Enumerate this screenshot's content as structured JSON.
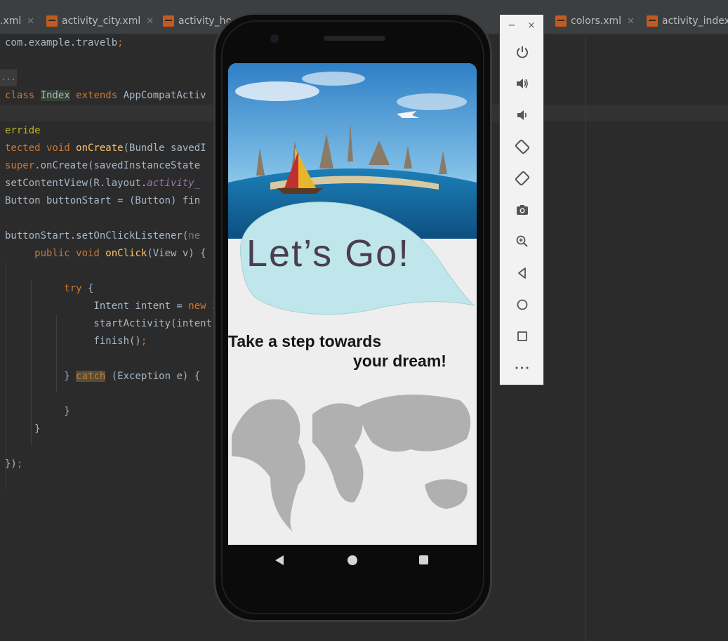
{
  "top_tabs": [
    {
      "label": ".xml"
    },
    {
      "label": "activity_city.xml"
    },
    {
      "label": "activity_ho"
    },
    {
      "label": "colors.xml"
    },
    {
      "label": "activity_index.x"
    }
  ],
  "editor": {
    "lines": [
      {
        "segments": [
          {
            "text": "com.example.travelb",
            "cls": ""
          },
          {
            "text": ";",
            "cls": "kw"
          }
        ]
      },
      {
        "segments": []
      },
      {
        "segments": []
      },
      {
        "segments": [
          {
            "text": "class ",
            "cls": "kw"
          },
          {
            "text": "Index",
            "cls": "cls-hl"
          },
          {
            "text": " extends ",
            "cls": "kw"
          },
          {
            "text": "AppCompatActiv",
            "cls": ""
          }
        ]
      },
      {
        "segments": []
      },
      {
        "segments": [
          {
            "text": "erride",
            "cls": "ann"
          }
        ]
      },
      {
        "segments": [
          {
            "text": "tected void ",
            "cls": "kw"
          },
          {
            "text": "onCreate",
            "cls": "fn"
          },
          {
            "text": "(Bundle savedI",
            "cls": ""
          }
        ]
      },
      {
        "segments": [
          {
            "text": "super",
            "cls": "kw"
          },
          {
            "text": ".onCreate(savedInstanceState",
            "cls": ""
          }
        ]
      },
      {
        "segments": [
          {
            "text": "setContentView(R.layout.",
            "cls": ""
          },
          {
            "text": "activity_",
            "cls": "it"
          }
        ]
      },
      {
        "segments": [
          {
            "text": "Button buttonStart = (Button) fin",
            "cls": ""
          }
        ]
      },
      {
        "segments": []
      },
      {
        "segments": [
          {
            "text": "buttonStart.setOnClickListener(",
            "cls": ""
          },
          {
            "text": "ne",
            "cls": "hint"
          }
        ]
      },
      {
        "segments": [
          {
            "text": "     public void ",
            "cls": "kw"
          },
          {
            "text": "onClick",
            "cls": "fn"
          },
          {
            "text": "(View v) {",
            "cls": ""
          }
        ]
      },
      {
        "segments": []
      },
      {
        "segments": [
          {
            "text": "          try ",
            "cls": "kw"
          },
          {
            "text": "{",
            "cls": ""
          }
        ]
      },
      {
        "segments": [
          {
            "text": "               Intent intent = ",
            "cls": ""
          },
          {
            "text": "new ",
            "cls": "kw"
          },
          {
            "text": "I",
            "cls": ""
          }
        ]
      },
      {
        "segments": [
          {
            "text": "               startActivity(intent)",
            "cls": ""
          }
        ]
      },
      {
        "segments": [
          {
            "text": "               finish()",
            "cls": ""
          },
          {
            "text": ";",
            "cls": "kw"
          }
        ]
      },
      {
        "segments": []
      },
      {
        "segments": [
          {
            "text": "          } ",
            "cls": ""
          },
          {
            "text": "catch",
            "cls": "kw catch-hl"
          },
          {
            "text": " (Exception e) {",
            "cls": ""
          }
        ]
      },
      {
        "segments": []
      },
      {
        "segments": [
          {
            "text": "          }",
            "cls": ""
          }
        ]
      },
      {
        "segments": [
          {
            "text": "     }",
            "cls": ""
          }
        ]
      },
      {
        "segments": []
      },
      {
        "segments": [
          {
            "text": "})",
            "cls": ""
          },
          {
            "text": ";",
            "cls": "kw"
          }
        ]
      }
    ]
  },
  "fold_marker": "...",
  "device": {
    "app": {
      "headline": "Let’s Go!",
      "tagline_line1": "Take a step towards",
      "tagline_line2": "your dream!"
    }
  },
  "emulator_toolbar": {
    "minimize": "−",
    "close": "×",
    "buttons": [
      {
        "name": "power-icon"
      },
      {
        "name": "volume-up-icon"
      },
      {
        "name": "volume-down-icon"
      },
      {
        "name": "rotate-left-icon"
      },
      {
        "name": "rotate-right-icon"
      },
      {
        "name": "camera-icon"
      },
      {
        "name": "zoom-icon"
      },
      {
        "name": "back-icon"
      },
      {
        "name": "home-icon"
      },
      {
        "name": "overview-icon"
      },
      {
        "name": "more-icon",
        "label": "•••"
      }
    ]
  },
  "colors": {
    "editor_bg": "#2b2b2b",
    "keyword": "#cc7832",
    "function": "#ffc66d",
    "bubble": "#bfe6ea",
    "map": "#b0b0b0"
  }
}
